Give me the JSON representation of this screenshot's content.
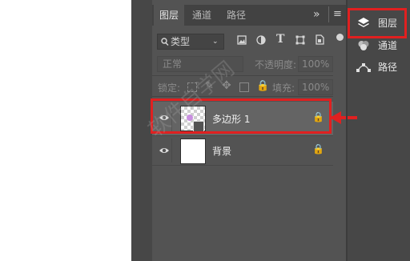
{
  "panel": {
    "tabs": [
      "图层",
      "通道",
      "路径"
    ],
    "menu_glyph": "≡",
    "collapse_glyph": "»",
    "filter": {
      "label": "类型",
      "icon": "search-icon"
    },
    "filter_icons": [
      "image-filter-icon",
      "adjustment-filter-icon",
      "text-filter-icon",
      "shape-filter-icon",
      "smart-object-filter-icon"
    ],
    "blend_mode": "正常",
    "opacity_label": "不透明度:",
    "opacity_value": "100%",
    "lock_label": "锁定:",
    "fill_label": "填充:",
    "fill_value": "100%"
  },
  "layers": [
    {
      "name": "多边形 1",
      "visible": true,
      "locked": true,
      "selected": true,
      "thumb": "checker-with-shape"
    },
    {
      "name": "背景",
      "visible": true,
      "locked": true,
      "selected": false,
      "thumb": "white"
    }
  ],
  "right_panel": {
    "items": [
      {
        "label": "图层",
        "icon": "layers-icon",
        "highlighted": true
      },
      {
        "label": "通道",
        "icon": "channels-icon"
      },
      {
        "label": "路径",
        "icon": "paths-icon"
      }
    ]
  },
  "colors": {
    "highlight_red": "#e02020",
    "panel_bg": "#535353",
    "app_bg": "#474747"
  },
  "watermark": "软件自学网"
}
